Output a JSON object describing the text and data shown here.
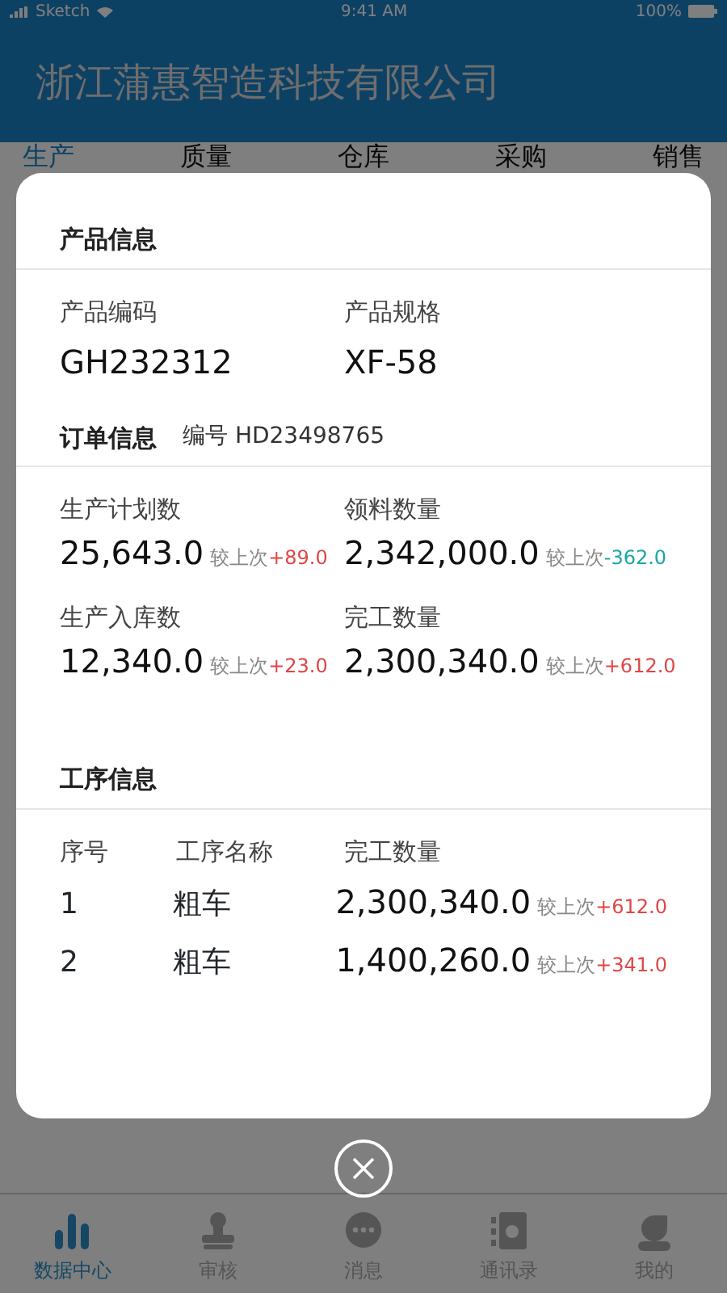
{
  "status_bar": {
    "carrier": "Sketch",
    "time": "9:41 AM",
    "battery": "100%"
  },
  "header": {
    "title": "浙江蒲惠智造科技有限公司"
  },
  "tabs": [
    {
      "label": "生产",
      "selected": true
    },
    {
      "label": "质量",
      "selected": false
    },
    {
      "label": "仓库",
      "selected": false
    },
    {
      "label": "采购",
      "selected": false
    },
    {
      "label": "销售",
      "selected": false
    }
  ],
  "modal": {
    "product": {
      "title": "产品信息",
      "fields": [
        {
          "label": "产品编码",
          "value": "GH232312"
        },
        {
          "label": "产品规格",
          "value": "XF-58"
        }
      ]
    },
    "order": {
      "title": "订单信息",
      "number_label": "编号",
      "number": "HD23498765",
      "metrics": [
        {
          "label": "生产计划数",
          "value": "25,643.0",
          "compare_label": "较上次",
          "change": "+89.0",
          "color": "#e04646"
        },
        {
          "label": "领料数量",
          "value": "2,342,000.0",
          "compare_label": "较上次",
          "change": "-362.0",
          "color": "#1aa6a0"
        },
        {
          "label": "生产入库数",
          "value": "12,340.0",
          "compare_label": "较上次",
          "change": "+23.0",
          "color": "#e04646"
        },
        {
          "label": "完工数量",
          "value": "2,300,340.0",
          "compare_label": "较上次",
          "change": "+612.0",
          "color": "#e04646"
        }
      ]
    },
    "process": {
      "title": "工序信息",
      "columns": [
        "序号",
        "工序名称",
        "完工数量"
      ],
      "rows": [
        {
          "index": "1",
          "name": "粗车",
          "value": "2,300,340.0",
          "compare_label": "较上次",
          "change": "+612.0",
          "color": "#e04646"
        },
        {
          "index": "2",
          "name": "粗车",
          "value": "1,400,260.0",
          "compare_label": "较上次",
          "change": "+341.0",
          "color": "#e04646"
        }
      ]
    }
  },
  "bottom_nav": [
    {
      "label": "数据中心",
      "selected": true
    },
    {
      "label": "审核",
      "selected": false
    },
    {
      "label": "消息",
      "selected": false
    },
    {
      "label": "通讯录",
      "selected": false
    },
    {
      "label": "我的",
      "selected": false
    }
  ]
}
